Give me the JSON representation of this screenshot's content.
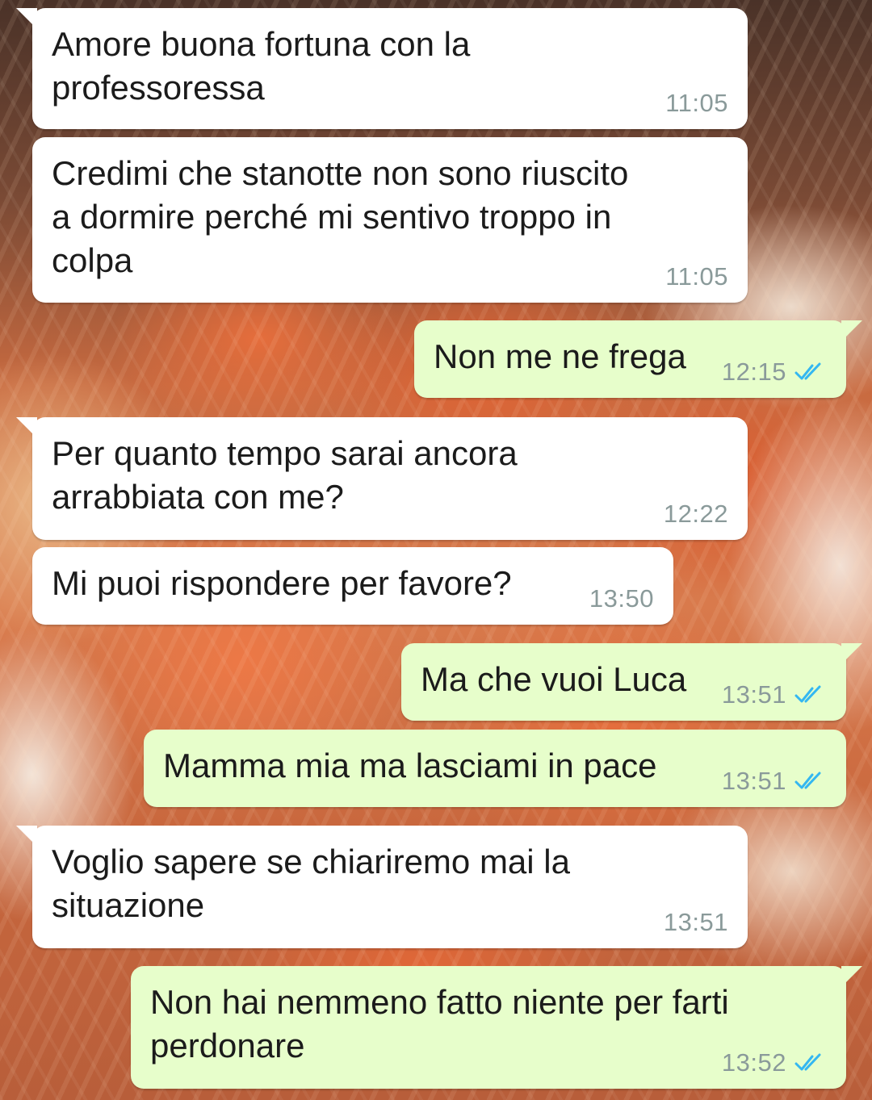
{
  "colors": {
    "incoming_bubble": "#ffffff",
    "outgoing_bubble": "#e7fecb",
    "timestamp": "#8a9a9a",
    "read_ticks": "#34b7f1"
  },
  "messages": [
    {
      "direction": "incoming",
      "text": "Amore buona fortuna con la\nprofessoressa",
      "time": "11:05"
    },
    {
      "direction": "incoming",
      "text": "Credimi che stanotte non sono riuscito\na dormire perché mi sentivo troppo in\ncolpa",
      "time": "11:05"
    },
    {
      "direction": "outgoing",
      "text": "Non me ne frega",
      "time": "12:15",
      "status_icon": "double-check-read-icon"
    },
    {
      "direction": "incoming",
      "text": "Per quanto tempo sarai ancora\narrabbiata con me?",
      "time": "12:22"
    },
    {
      "direction": "incoming",
      "text": "Mi puoi rispondere per favore?",
      "time": "13:50"
    },
    {
      "direction": "outgoing",
      "text": "Ma che vuoi Luca",
      "time": "13:51",
      "status_icon": "double-check-read-icon"
    },
    {
      "direction": "outgoing",
      "text": "Mamma mia ma lasciami in pace",
      "time": "13:51",
      "status_icon": "double-check-read-icon"
    },
    {
      "direction": "incoming",
      "text": "Voglio sapere se chiariremo mai la\nsituazione",
      "time": "13:51"
    },
    {
      "direction": "outgoing",
      "text": "Non hai nemmeno fatto niente per farti\nperdonare",
      "time": "13:52",
      "status_icon": "double-check-read-icon"
    }
  ]
}
